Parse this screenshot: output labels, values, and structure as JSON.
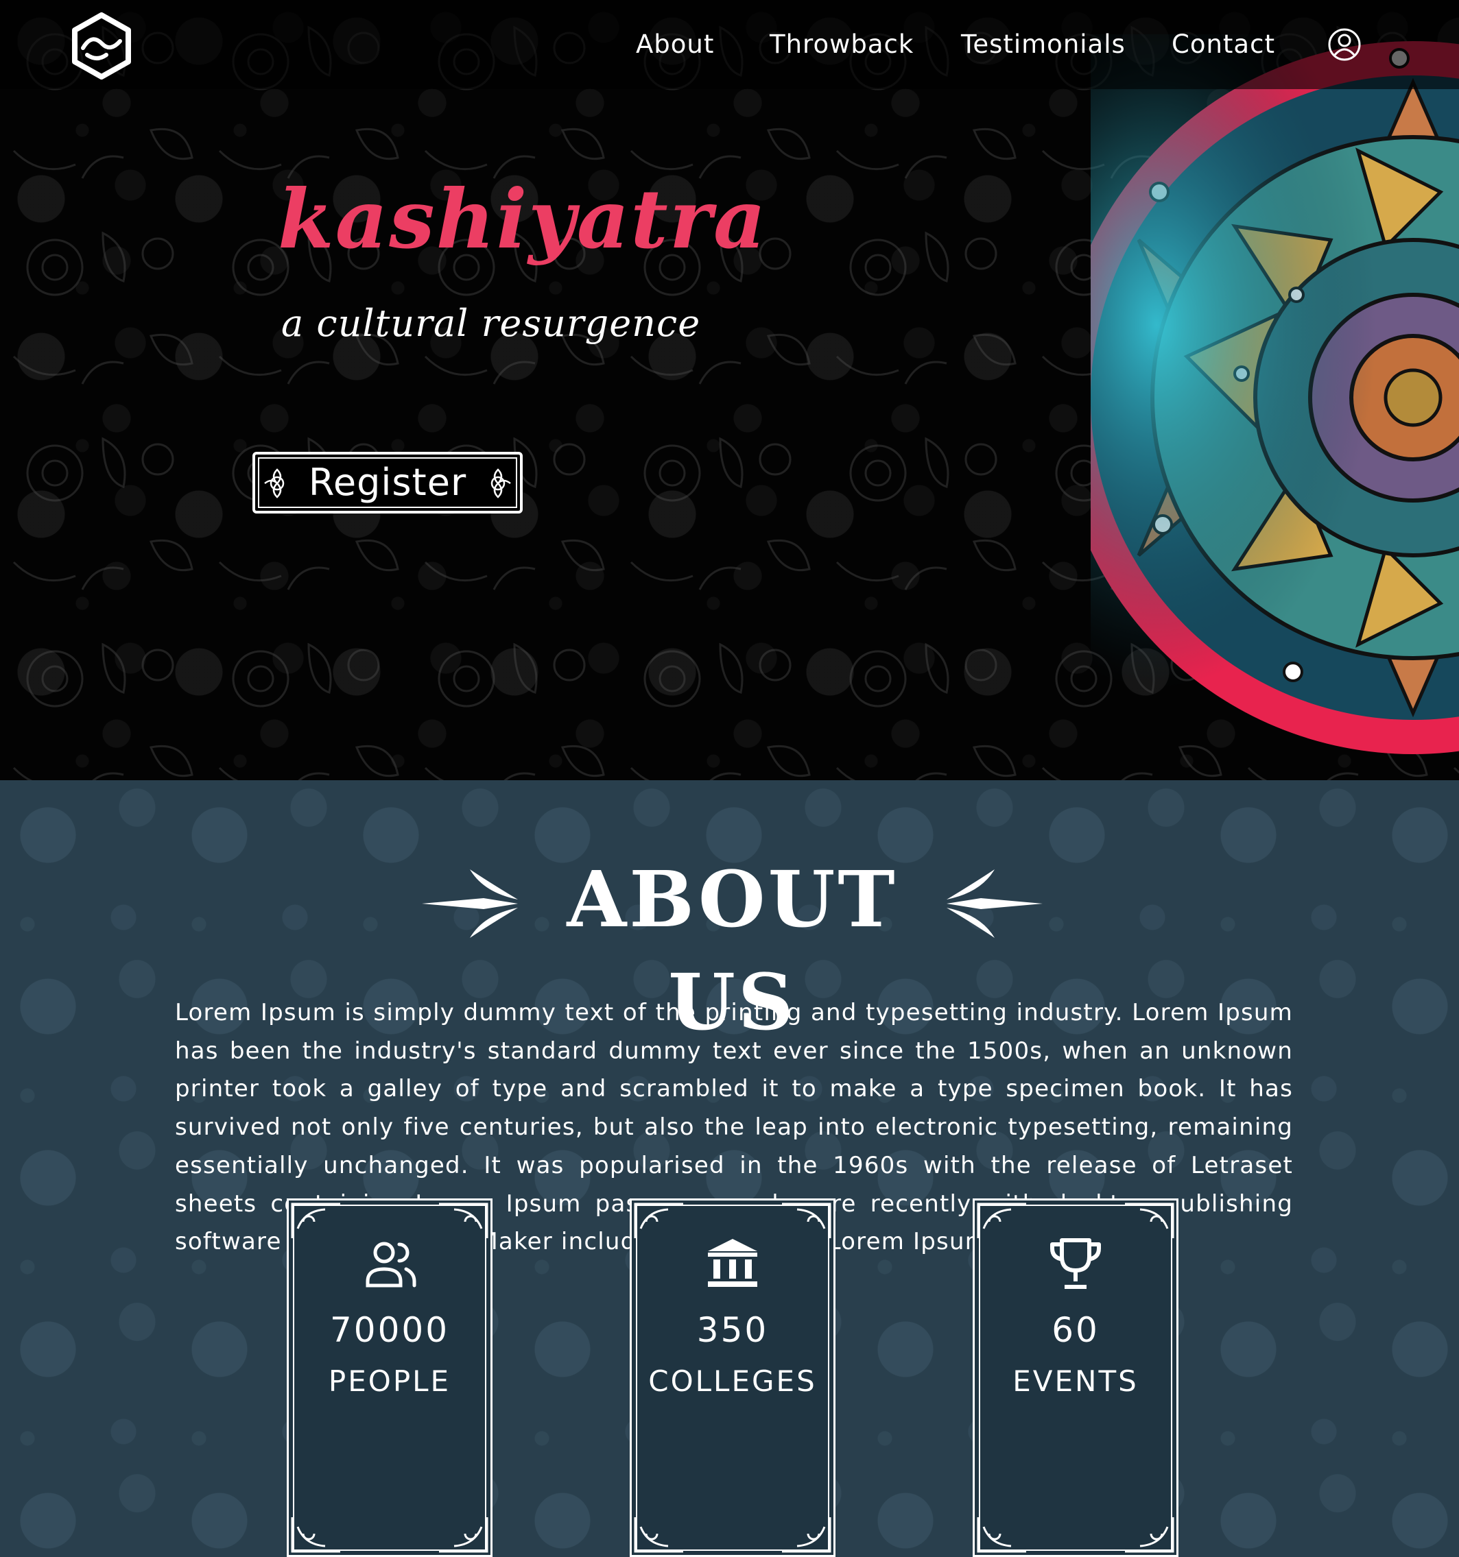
{
  "nav": {
    "links": [
      "About",
      "Throwback",
      "Testimonials",
      "Contact"
    ],
    "logo_icon": "hexagon-wave-logo",
    "user_icon": "user-circle-icon"
  },
  "hero": {
    "title": "kashiyatra",
    "subtitle": "a cultural resurgence",
    "register_label": "Register",
    "title_color": "#ec3e63"
  },
  "about": {
    "heading": "ABOUT US",
    "body": "Lorem Ipsum is simply dummy text of the printing and typesetting industry. Lorem Ipsum has been the industry's standard dummy text ever since the 1500s, when an unknown printer took a galley of type and scrambled it to make a type specimen book. It has survived not only five centuries, but also the leap into electronic typesetting, remaining essentially unchanged. It was popularised in the 1960s with the release of Letraset sheets containing Lorem Ipsum passages, and more recently with desktop publishing software like Aldus PageMaker including versions of Lorem Ipsum.",
    "background_color": "#293f4d",
    "stats": [
      {
        "icon": "people-icon",
        "number": "70000",
        "label": "PEOPLE"
      },
      {
        "icon": "college-building-icon",
        "number": "350",
        "label": "COLLEGES"
      },
      {
        "icon": "trophy-icon",
        "number": "60",
        "label": "EVENTS"
      }
    ]
  }
}
